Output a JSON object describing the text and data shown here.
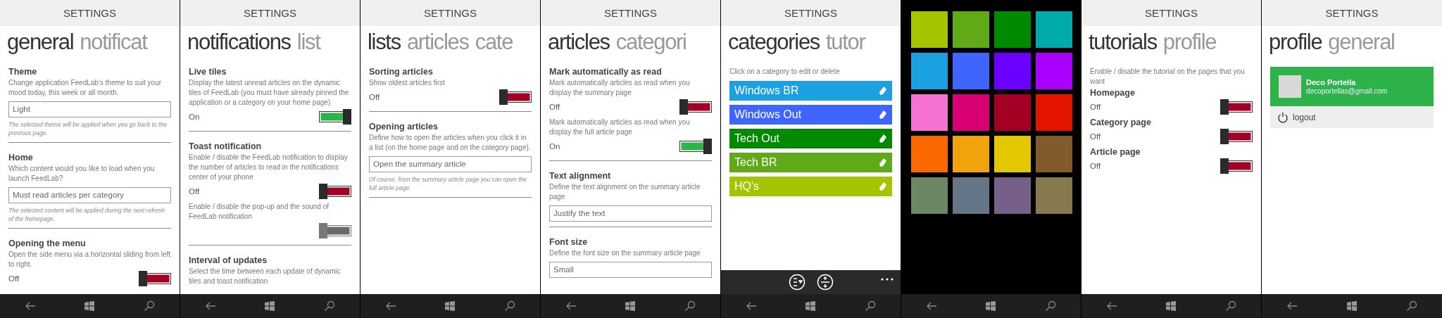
{
  "screens": [
    {
      "kind": "settings",
      "title": "SETTINGS",
      "pivot": [
        {
          "label": "general",
          "selected": true
        },
        {
          "label": "notificat",
          "selected": false
        }
      ],
      "items": [
        {
          "kind": "heading",
          "text": "Theme"
        },
        {
          "kind": "desc",
          "text": "Change application FeedLab's theme to suit your mood today, this week or all month."
        },
        {
          "kind": "field",
          "value": "Light"
        },
        {
          "kind": "note",
          "text": "The selected theme will be applied when you go back to the previous page."
        },
        {
          "kind": "divider"
        },
        {
          "kind": "heading",
          "text": "Home"
        },
        {
          "kind": "desc",
          "text": "Which content would you like to load when you launch FeedLab?"
        },
        {
          "kind": "field",
          "value": "Must read articles per category"
        },
        {
          "kind": "note",
          "text": "The selected content will be applied during the next refresh of the homepage."
        },
        {
          "kind": "divider"
        },
        {
          "kind": "heading",
          "text": "Opening the menu"
        },
        {
          "kind": "desc",
          "text": "Open the side menu via a horizontal sliding from left to right."
        },
        {
          "kind": "toggle",
          "label": "Off",
          "on": false
        }
      ]
    },
    {
      "kind": "settings",
      "title": "SETTINGS",
      "pivot": [
        {
          "label": "notifications",
          "selected": true
        },
        {
          "label": "list",
          "selected": false
        }
      ],
      "items": [
        {
          "kind": "heading",
          "text": "Live tiles"
        },
        {
          "kind": "desc",
          "text": "Display the latest unread articles on the dynamic tiles of FeedLab (you must have already pinned the application or a category on your home page)"
        },
        {
          "kind": "toggle",
          "label": "On",
          "on": true
        },
        {
          "kind": "divider"
        },
        {
          "kind": "heading",
          "text": "Toast notification"
        },
        {
          "kind": "desc",
          "text": "Enable / disable the FeedLab notification to display the number of articles to read in the notifications center of your phone"
        },
        {
          "kind": "toggle",
          "label": "Off",
          "on": false
        },
        {
          "kind": "desc",
          "text": "Enable / disable the pop-up and the sound of FeedLab notification"
        },
        {
          "kind": "toggle",
          "on": false,
          "disabled": true
        },
        {
          "kind": "divider"
        },
        {
          "kind": "heading",
          "text": "Interval of updates"
        },
        {
          "kind": "desc",
          "text": "Select the time between each update of dynamic tiles and toast notification"
        }
      ]
    },
    {
      "kind": "settings",
      "title": "SETTINGS",
      "pivot": [
        {
          "label": "lists",
          "selected": true
        },
        {
          "label": "articles",
          "selected": false
        },
        {
          "label": "cate",
          "selected": false
        }
      ],
      "items": [
        {
          "kind": "heading",
          "text": "Sorting articles"
        },
        {
          "kind": "desc",
          "text": "Show oldest articles first"
        },
        {
          "kind": "toggle",
          "label": "Off",
          "on": false
        },
        {
          "kind": "divider"
        },
        {
          "kind": "heading",
          "text": "Opening articles"
        },
        {
          "kind": "desc",
          "text": "Define how to open the articles when you click it in a list (on the home page and on the category page)."
        },
        {
          "kind": "field",
          "value": "Open the summary article"
        },
        {
          "kind": "note",
          "text": "Of course, from the summary article page you can open the full article page."
        },
        {
          "kind": "divider"
        }
      ]
    },
    {
      "kind": "settings",
      "title": "SETTINGS",
      "pivot": [
        {
          "label": "articles",
          "selected": true
        },
        {
          "label": "categori",
          "selected": false
        }
      ],
      "items": [
        {
          "kind": "heading",
          "text": "Mark automatically as read"
        },
        {
          "kind": "desc",
          "text": "Mark automatically articles as read when you display the summary page"
        },
        {
          "kind": "toggle",
          "label": "Off",
          "on": false
        },
        {
          "kind": "desc",
          "text": "Mark automatically articles as read when you display the full article page"
        },
        {
          "kind": "toggle",
          "label": "On",
          "on": true
        },
        {
          "kind": "divider"
        },
        {
          "kind": "heading",
          "text": "Text alignment"
        },
        {
          "kind": "desc",
          "text": "Define the text alignment on the summary article page"
        },
        {
          "kind": "field",
          "value": "Justify the text"
        },
        {
          "kind": "divider"
        },
        {
          "kind": "heading",
          "text": "Font size"
        },
        {
          "kind": "desc",
          "text": "Define the font size on the summary article page"
        },
        {
          "kind": "field",
          "value": "Small"
        }
      ]
    },
    {
      "kind": "settings",
      "title": "SETTINGS",
      "app_bar": true,
      "pivot": [
        {
          "label": "categories",
          "selected": true
        },
        {
          "label": "tutor",
          "selected": false
        }
      ],
      "items": [
        {
          "kind": "desc",
          "text": "Click on a category to edit or delete"
        },
        {
          "kind": "category",
          "label": "Windows BR",
          "color": "#1ba1e2"
        },
        {
          "kind": "category",
          "label": "Windows Out",
          "color": "#3e65ff"
        },
        {
          "kind": "category",
          "label": "Tech Out",
          "color": "#008a00"
        },
        {
          "kind": "category",
          "label": "Tech BR",
          "color": "#60a917"
        },
        {
          "kind": "category",
          "label": "HQ's",
          "color": "#a4c400"
        }
      ]
    },
    {
      "kind": "palette",
      "swatches": [
        {
          "color": "#a4c400"
        },
        {
          "color": "#60a917"
        },
        {
          "color": "#008a00"
        },
        {
          "color": "#00aba9"
        },
        {
          "color": "#1ba1e2"
        },
        {
          "color": "#3e65ff"
        },
        {
          "color": "#6a00ff"
        },
        {
          "color": "#aa00ff"
        },
        {
          "color": "#f472d0"
        },
        {
          "color": "#d80073"
        },
        {
          "color": "#a20025"
        },
        {
          "color": "#e51400"
        },
        {
          "color": "#fa6800"
        },
        {
          "color": "#f0a30a"
        },
        {
          "color": "#e3c800"
        },
        {
          "color": "#825a2c"
        },
        {
          "color": "#6d8764"
        },
        {
          "color": "#647687"
        },
        {
          "color": "#76608a"
        },
        {
          "color": "#87794e"
        }
      ]
    },
    {
      "kind": "settings",
      "title": "SETTINGS",
      "pivot": [
        {
          "label": "tutorials",
          "selected": true
        },
        {
          "label": "profile",
          "selected": false
        }
      ],
      "items": [
        {
          "kind": "desc",
          "text": "Enable / disable the tutorial on the pages that you want"
        },
        {
          "kind": "heading",
          "text": "Homepage"
        },
        {
          "kind": "toggle",
          "label": "Off",
          "on": false
        },
        {
          "kind": "heading",
          "text": "Category page"
        },
        {
          "kind": "toggle",
          "label": "Off",
          "on": false
        },
        {
          "kind": "heading",
          "text": "Article page"
        },
        {
          "kind": "toggle",
          "label": "Off",
          "on": false
        }
      ]
    },
    {
      "kind": "settings",
      "title": "SETTINGS",
      "pivot": [
        {
          "label": "profile",
          "selected": true
        },
        {
          "label": "general",
          "selected": false
        }
      ],
      "items": [
        {
          "kind": "profile",
          "name": "Deco Portella",
          "email": "decoportellas@gmail.com"
        },
        {
          "kind": "logout",
          "label": "logout"
        }
      ]
    }
  ]
}
